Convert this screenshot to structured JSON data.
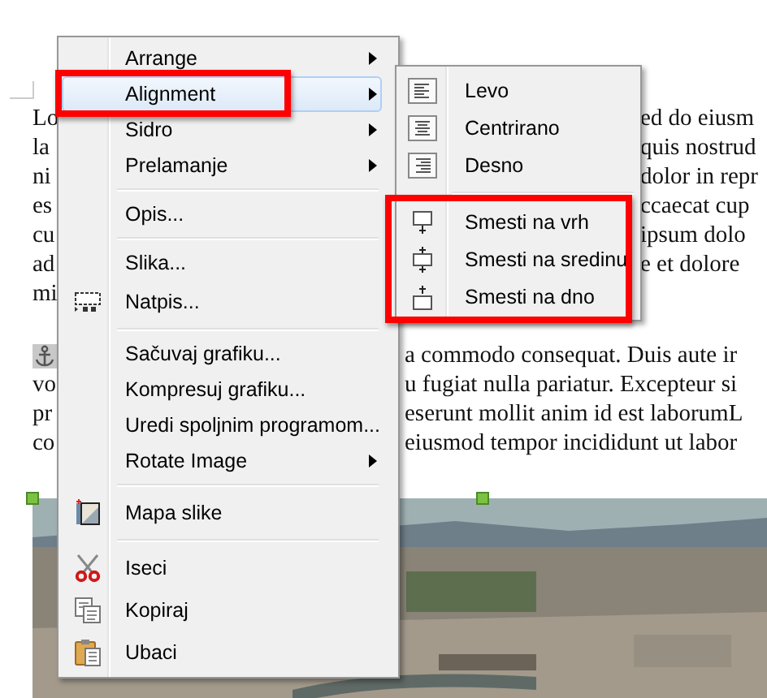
{
  "document": {
    "blocks": [
      {
        "kind": "upper",
        "lines": [
          {
            "left": "Lo",
            "right": "ed do eiusm"
          },
          {
            "left": "la",
            "right": "quis nostrud"
          },
          {
            "left": "ni",
            "right": "dolor in repr"
          },
          {
            "left": "es",
            "right": "ccaecat cup"
          },
          {
            "left": "cu",
            "right": "ipsum dolo"
          },
          {
            "left": "ad",
            "right": "e et dolore"
          },
          {
            "left": "mi"
          }
        ]
      },
      {
        "kind": "lower",
        "lines": [
          {
            "right": "a commodo consequat. Duis aute ir",
            "anchor": true
          },
          {
            "left": "vo",
            "right": "u fugiat nulla pariatur. Excepteur si"
          },
          {
            "left": "pr",
            "right": "eserunt mollit anim id est laborumL"
          },
          {
            "left": "co",
            "right": "eiusmod tempor incididunt ut labor"
          }
        ]
      }
    ],
    "image": {
      "selected": true
    }
  },
  "context_menu": {
    "items": [
      {
        "kind": "item",
        "label": "Arrange",
        "submenu": true,
        "selected": false
      },
      {
        "kind": "item",
        "label": "Alignment",
        "submenu": true,
        "selected": true,
        "highlighted": true
      },
      {
        "kind": "item",
        "label": "Sidro",
        "submenu": true,
        "selected": false
      },
      {
        "kind": "item",
        "label": "Prelamanje",
        "submenu": true,
        "selected": false
      },
      {
        "kind": "separator"
      },
      {
        "kind": "item",
        "label": "Opis...",
        "submenu": false,
        "selected": false
      },
      {
        "kind": "separator"
      },
      {
        "kind": "item",
        "label": "Slika...",
        "submenu": false,
        "selected": false
      },
      {
        "kind": "item",
        "label": "Natpis...",
        "submenu": false,
        "selected": false
      },
      {
        "kind": "separator"
      },
      {
        "kind": "item",
        "label": "Sačuvaj grafiku...",
        "submenu": false,
        "selected": false
      },
      {
        "kind": "item",
        "label": "Kompresuj grafiku...",
        "submenu": false,
        "selected": false
      },
      {
        "kind": "item",
        "label": "Uredi spoljnim programom...",
        "submenu": false,
        "selected": false
      },
      {
        "kind": "item",
        "label": "Rotate Image",
        "submenu": true,
        "selected": false
      },
      {
        "kind": "separator"
      },
      {
        "kind": "item",
        "label": "Mapa slike",
        "submenu": false,
        "selected": false
      },
      {
        "kind": "separator"
      },
      {
        "kind": "item",
        "label": "Iseci",
        "submenu": false,
        "selected": false
      },
      {
        "kind": "item",
        "label": "Kopiraj",
        "submenu": false,
        "selected": false
      },
      {
        "kind": "item",
        "label": "Ubaci",
        "submenu": false,
        "selected": false
      }
    ]
  },
  "alignment_submenu": {
    "sections": [
      {
        "highlighted": false,
        "items": [
          {
            "label": "Levo"
          },
          {
            "label": "Centrirano"
          },
          {
            "label": "Desno"
          }
        ]
      },
      {
        "highlighted": true,
        "items": [
          {
            "label": "Smesti na vrh"
          },
          {
            "label": "Smesti na sredinu"
          },
          {
            "label": "Smesti na dno"
          }
        ]
      }
    ]
  }
}
